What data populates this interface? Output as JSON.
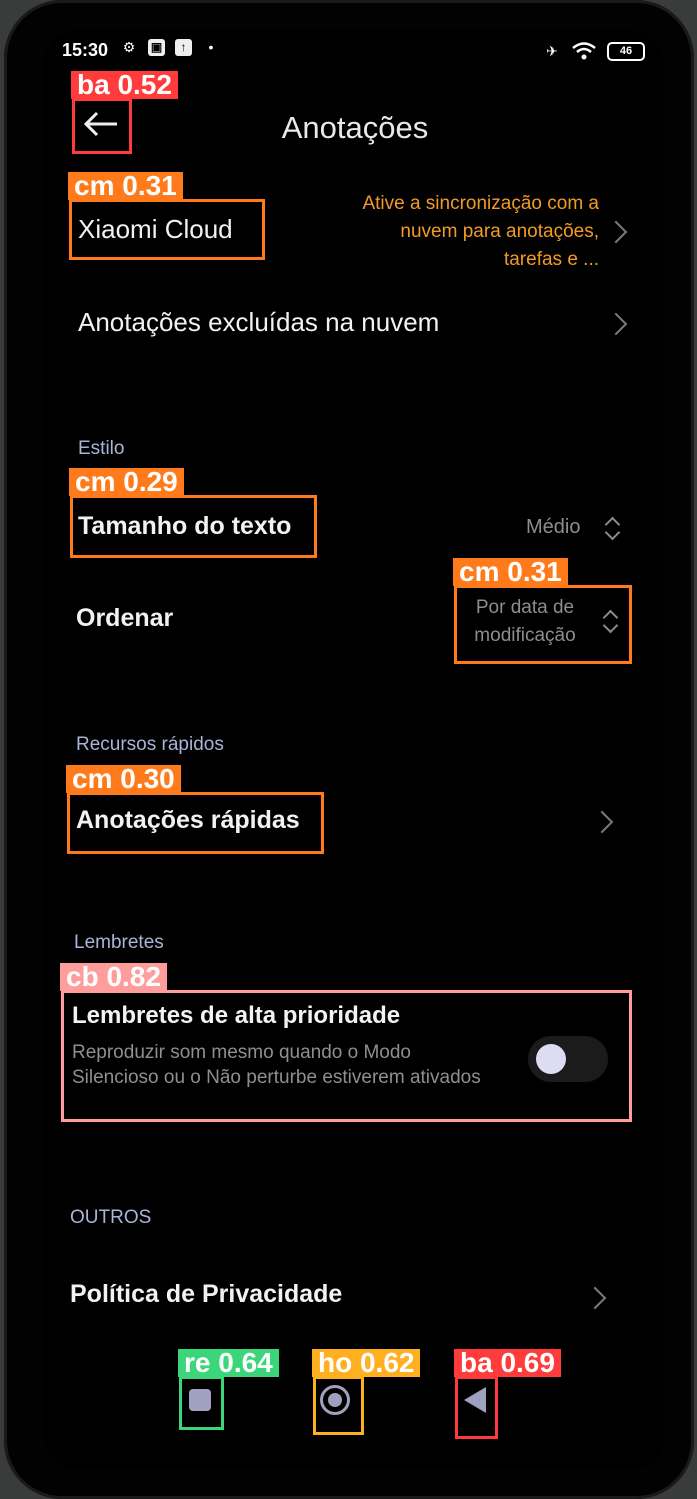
{
  "status_bar": {
    "time": "15:30",
    "icons": [
      "settings-gear-icon",
      "photo-icon",
      "upload-icon",
      "dot-icon"
    ],
    "battery": "46"
  },
  "header": {
    "title": "Anotações",
    "back_icon": "back-arrow-icon"
  },
  "cloud": {
    "label": "Xiaomi Cloud",
    "note": "Ative a sincronização com a nuvem para anotações, tarefas e ..."
  },
  "deleted": {
    "label": "Anotações excluídas na nuvem"
  },
  "style_section": {
    "title": "Estilo",
    "text_size": {
      "label": "Tamanho do texto",
      "value": "Médio"
    },
    "sort": {
      "label": "Ordenar",
      "value": "Por data de modificação"
    }
  },
  "quick_section": {
    "title": "Recursos rápidos",
    "quick_notes": {
      "label": "Anotações rápidas"
    }
  },
  "reminders_section": {
    "title": "Lembretes",
    "high_priority": {
      "label": "Lembretes de alta prioridade",
      "description": "Reproduzir som mesmo quando o Modo Silencioso ou o Não perturbe estiverem ativados",
      "enabled": false
    }
  },
  "others_section": {
    "title": "OUTROS",
    "privacy": {
      "label": "Política de Privacidade"
    }
  },
  "detections": [
    {
      "tag": "ba 0.52",
      "color": "#ff3b3b"
    },
    {
      "tag": "cm 0.31",
      "color": "#ff7a1a"
    },
    {
      "tag": "cm 0.29",
      "color": "#ff7a1a"
    },
    {
      "tag": "cm 0.31",
      "color": "#ff7a1a"
    },
    {
      "tag": "cm 0.30",
      "color": "#ff7a1a"
    },
    {
      "tag": "cb 0.82",
      "color": "#ff9d9d"
    },
    {
      "tag": "re 0.64",
      "color": "#3bd67a"
    },
    {
      "tag": "ho 0.62",
      "color": "#ffb020"
    },
    {
      "tag": "ba 0.69",
      "color": "#ff3b3b"
    }
  ]
}
